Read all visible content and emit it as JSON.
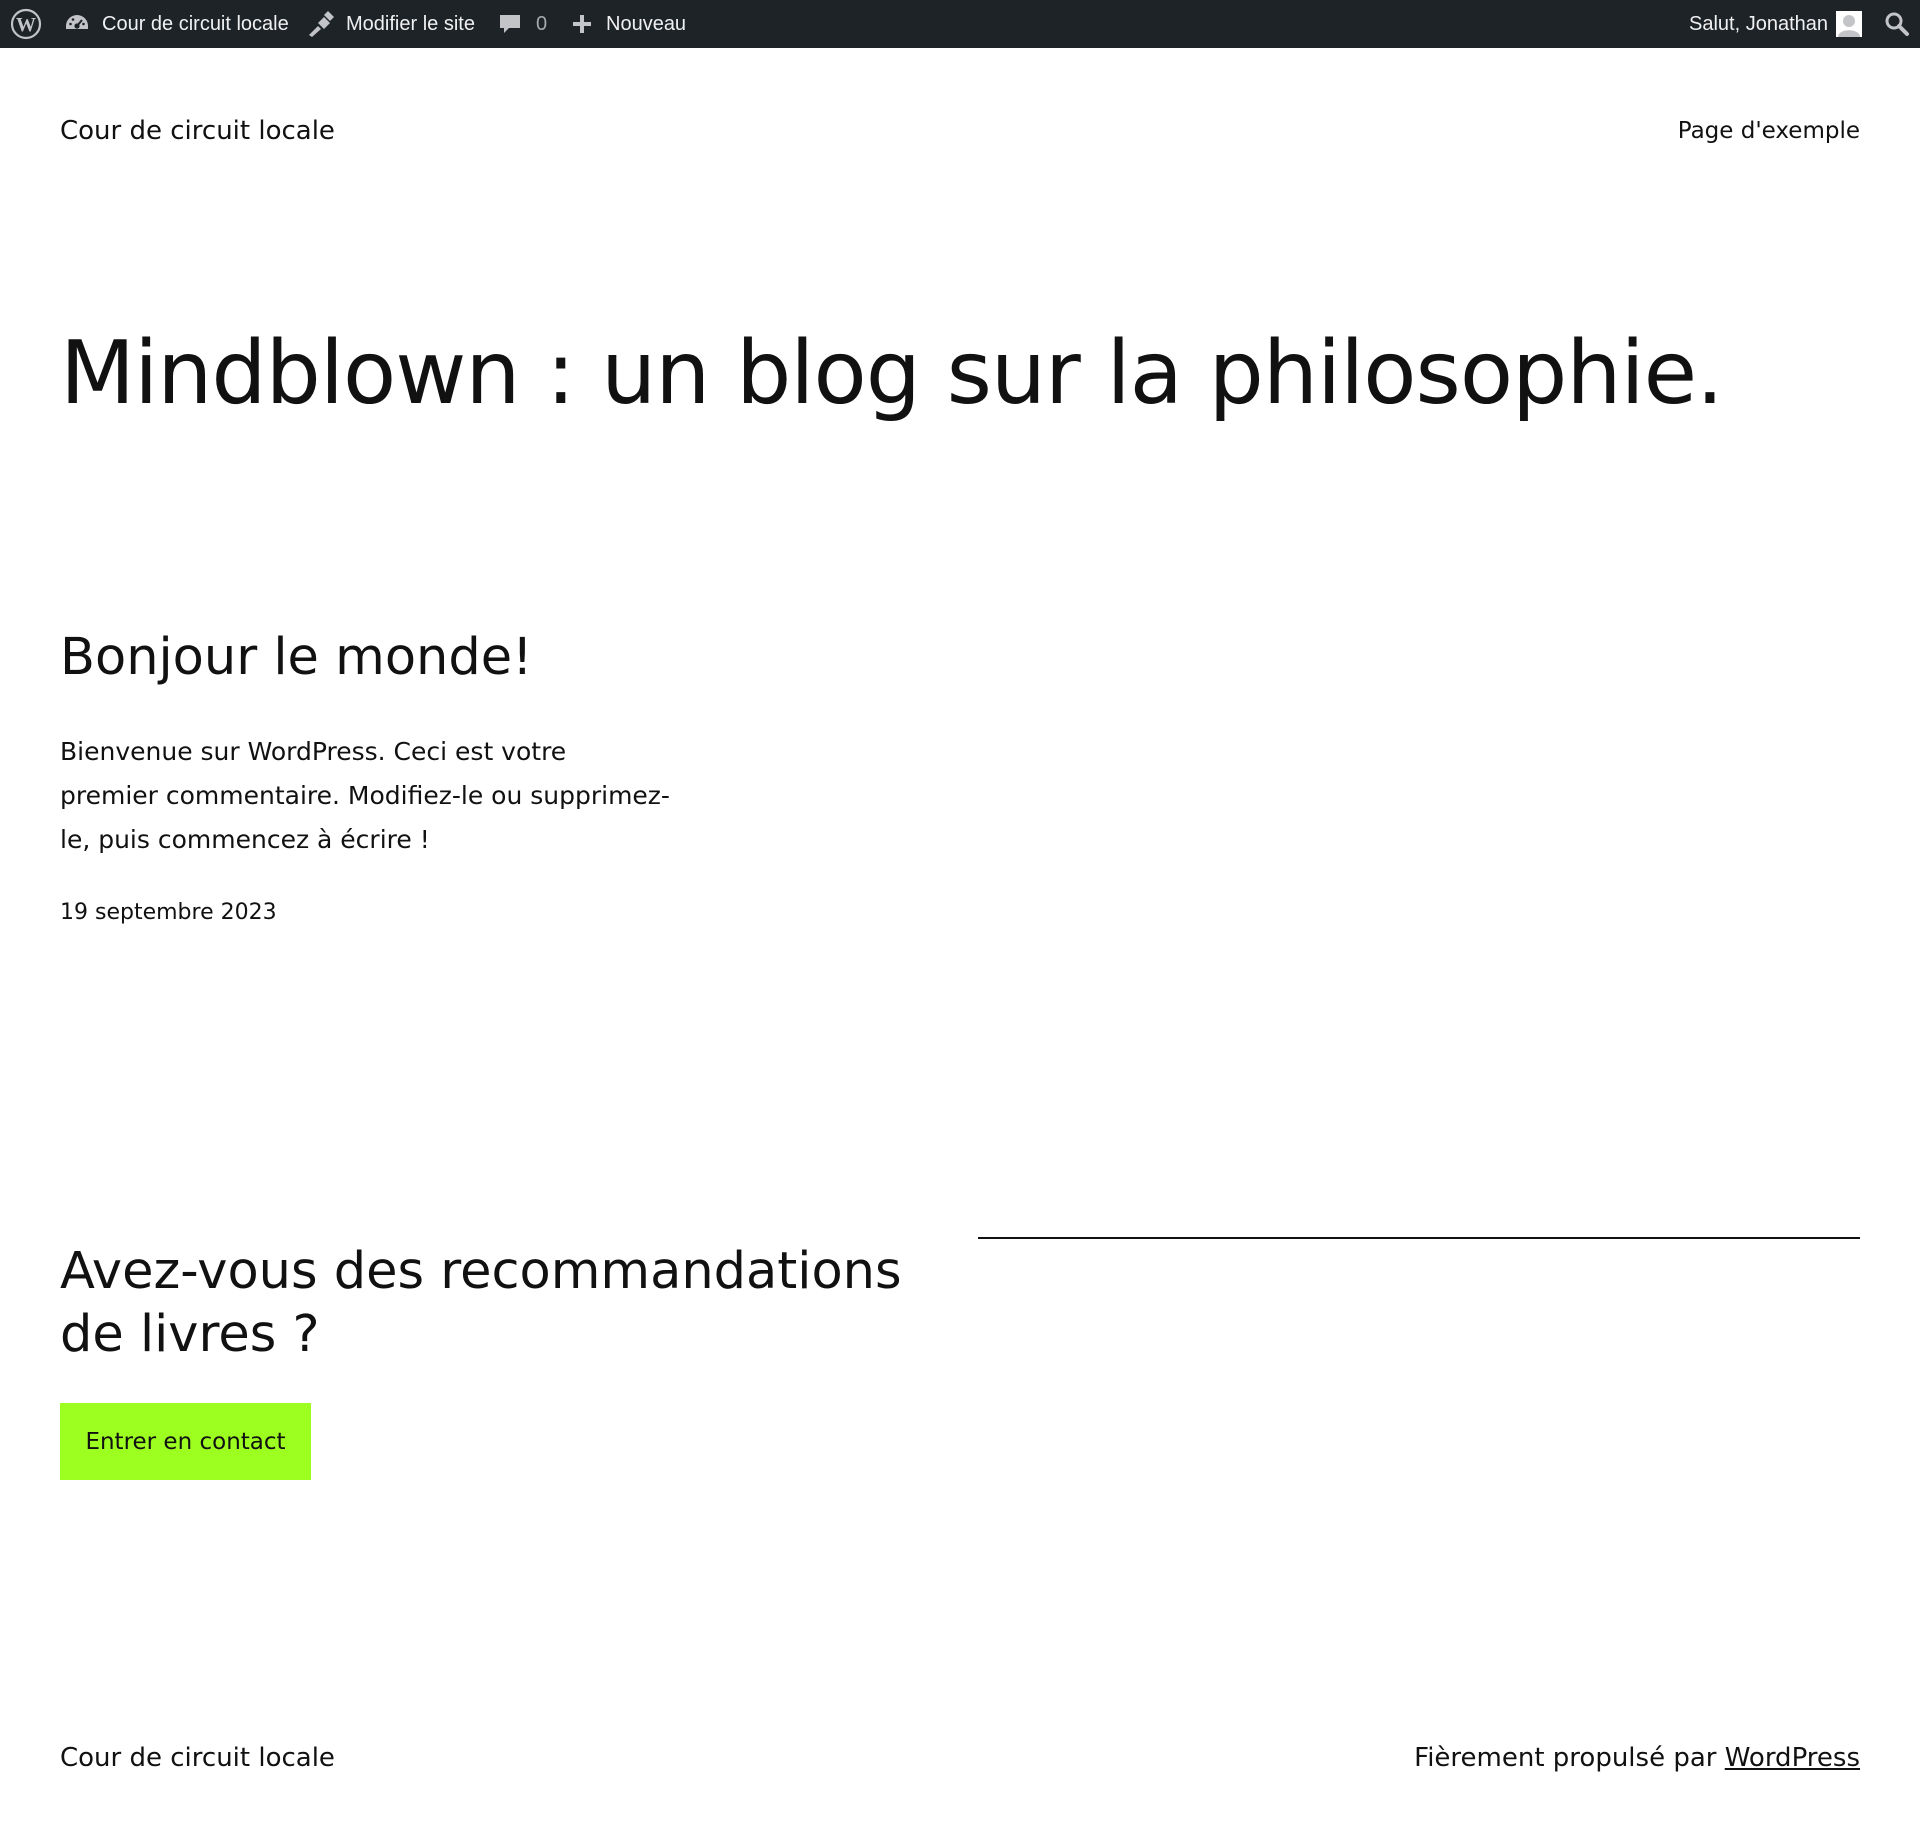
{
  "admin_bar": {
    "site_name": "Cour de circuit locale",
    "edit_site": "Modifier le site",
    "comments_count": "0",
    "new_label": "Nouveau",
    "greeting": "Salut, Jonathan"
  },
  "header": {
    "site_title": "Cour de circuit locale",
    "nav": [
      "Page d'exemple"
    ]
  },
  "hero": {
    "heading": "Mindblown : un blog sur la philosophie."
  },
  "post": {
    "title": "Bonjour le monde!",
    "excerpt": "Bienvenue sur WordPress. Ceci est votre premier commentaire. Modifiez-le ou supprimez-le, puis commencez à écrire !",
    "date": "19 septembre 2023"
  },
  "cta": {
    "heading": "Avez-vous des recommandations de livres ?",
    "button_label": "Entrer en contact",
    "button_color": "#9dff20"
  },
  "footer": {
    "site_title": "Cour de circuit locale",
    "credit_prefix": "Fièrement propulsé par",
    "credit_link": "WordPress"
  },
  "colors": {
    "admin_bar_bg": "#1d2327",
    "text": "#111111",
    "accent": "#9dff20"
  },
  "icons": {
    "wordpress": "wordpress-logo-icon",
    "dashboard": "dashboard-gauge-icon",
    "edit": "brush-icon",
    "comments": "speech-bubble-icon",
    "new": "plus-icon",
    "avatar": "user-avatar-icon",
    "search": "search-icon"
  }
}
